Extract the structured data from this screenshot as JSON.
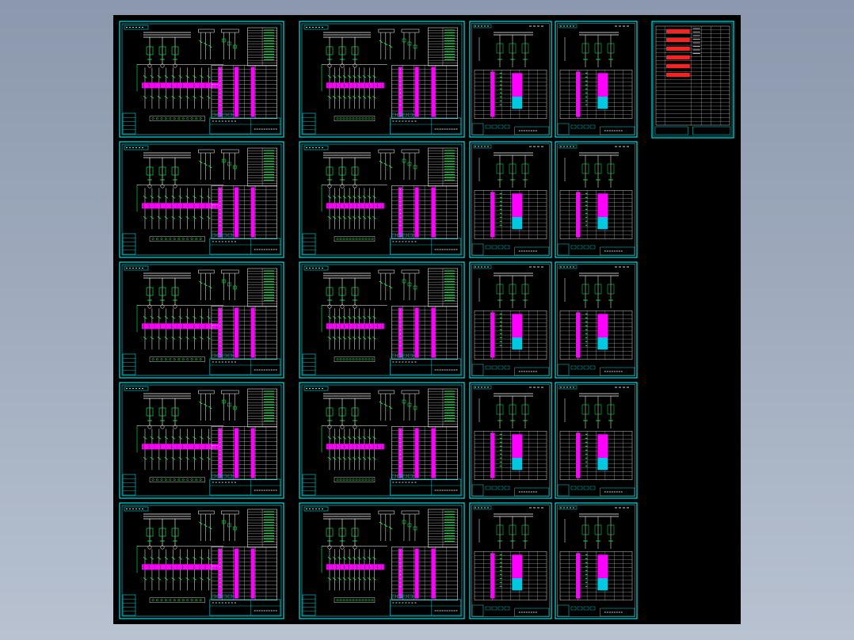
{
  "viewer": {
    "background_top": "#8b98ad",
    "background_bottom": "#b8c2d1",
    "model_space_color": "#000000"
  },
  "colors": {
    "frame": "#00e0e6",
    "wire": "#ffffff",
    "component": "#00ff40",
    "highlight": "#ff00ff",
    "note": "#ff2020",
    "title_text": "#ffffff"
  },
  "layout": {
    "row_count": 5,
    "large_sheet_columns": 2,
    "small_sheet_columns": 2,
    "index_sheet_count": 1
  },
  "drawing": {
    "sheet_kinds": [
      "large-schematic",
      "large-schematic",
      "small-schematic",
      "small-schematic"
    ],
    "index_sheet_kind": "drawing-list-table"
  }
}
